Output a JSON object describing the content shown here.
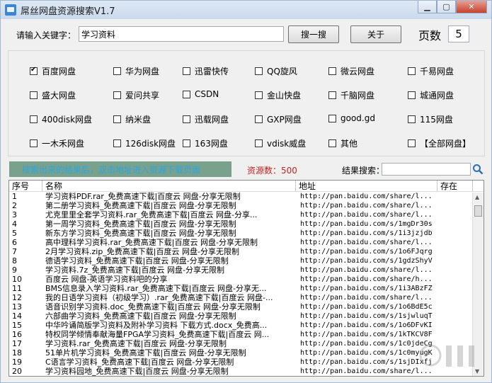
{
  "window": {
    "title": "屌丝网盘资源搜索V1.7"
  },
  "search": {
    "label": "请输入关键字：",
    "value": "学习资料",
    "search_button": "搜一搜",
    "about_button": "关于",
    "pages_label": "页数",
    "pages_value": "5"
  },
  "providers": [
    {
      "label": "百度网盘",
      "checked": true
    },
    {
      "label": "华为网盘",
      "checked": false
    },
    {
      "label": "迅雷快传",
      "checked": false
    },
    {
      "label": "QQ旋风",
      "checked": false
    },
    {
      "label": "微云网盘",
      "checked": false
    },
    {
      "label": "千易网盘",
      "checked": false
    },
    {
      "label": "盛大网盘",
      "checked": false
    },
    {
      "label": "爱问共享",
      "checked": false
    },
    {
      "label": "CSDN",
      "checked": false
    },
    {
      "label": "金山快盘",
      "checked": false
    },
    {
      "label": "千脑网盘",
      "checked": false
    },
    {
      "label": "城通网盘",
      "checked": false
    },
    {
      "label": "400disk网盘",
      "checked": false
    },
    {
      "label": "纳米盘",
      "checked": false
    },
    {
      "label": "迅载网盘",
      "checked": false
    },
    {
      "label": "GXP网盘",
      "checked": false
    },
    {
      "label": "good.gd",
      "checked": false
    },
    {
      "label": "115网盘",
      "checked": false
    },
    {
      "label": "一木禾网盘",
      "checked": false
    },
    {
      "label": "126disk网盘",
      "checked": false
    },
    {
      "label": "163网盘",
      "checked": false
    },
    {
      "label": "vdisk威盘",
      "checked": false
    },
    {
      "label": "其他",
      "checked": false
    },
    {
      "label": "【全部网盘】",
      "checked": false
    }
  ],
  "status": {
    "hint": "搜索出来的结果后，双击地址进入资源下载页面",
    "count": "资源数：500",
    "result_search_label": "结果搜索："
  },
  "table": {
    "headers": [
      "序号",
      "名称",
      "地址",
      "存在"
    ],
    "rows": [
      [
        "1",
        "学习资料PDF.rar_免费高速下载|百度云 网盘-分享无限制",
        "http://pan.baidu.com/share/l..."
      ],
      [
        "2",
        "第二册学习资料_免费高速下载|百度云 网盘-分享无限制",
        "http://pan.baidu.com/share/l..."
      ],
      [
        "3",
        "尤克里里全套学习资料.rar_免费高速下载|百度云 网盘-分享...",
        "http://pan.baidu.com/share/l..."
      ],
      [
        "4",
        "第一周学习资料_免费高速下载|百度云 网盘-分享无限制",
        "http://pan.baidu.com/s/1mgDr30s"
      ],
      [
        "5",
        "新东方学习资料_免费高速下载|百度云 网盘-分享无限制",
        "http://pan.baidu.com/s/1i3jzjdb"
      ],
      [
        "6",
        "高中理科学习资料.rar_免费高速下载|百度云 网盘-分享无限制",
        "http://pan.baidu.com/share/l..."
      ],
      [
        "7",
        "2月学习资料.zip_免费高速下载|百度云 网盘-分享无限制",
        "http://pan.baidu.com/s/1o6FJqrg"
      ],
      [
        "8",
        "德语学习资料_免费高速下载|百度云 网盘-分享无限制",
        "http://pan.baidu.com/s/1gdzShyV"
      ],
      [
        "9",
        "学习资料.7z_免费高速下载|百度云 网盘-分享无限制",
        "http://pan.baidu.com/share/l..."
      ],
      [
        "10",
        "百度云 网盘-英语学习资料吧的分享",
        "http://pan.baidu.com/share/h..."
      ],
      [
        "11",
        "BMS信息录入学习资料.rar_免费高速下载|百度云 网盘-分享无...",
        "http://pan.baidu.com/s/1i3ABzFZ"
      ],
      [
        "12",
        "我的日语学习资料（初级学习）.rar_免费高速下载|百度云 网盘-...",
        "http://pan.baidu.com/share/l..."
      ],
      [
        "13",
        "语音识别学习资料.doc_免费高速下载|百度云 网盘-分享无限制",
        "http://pan.baidu.com/s/1o6BdE5c"
      ],
      [
        "14",
        "六部曲学习资料_免费高速下载|百度云 网盘-分享无限制",
        "http://pan.baidu.com/s/1sjwluqT"
      ],
      [
        "15",
        "中华吟诵简版学习资料及附补学习资料 下载方式.docx_免费高...",
        "http://pan.baidu.com/s/1o6DFvKI"
      ],
      [
        "16",
        "特权同学倾情奉献海量FPGA学习资料_免费高速下载|百度云 网...",
        "http://pan.baidu.com/s/1kTKCV8F"
      ],
      [
        "17",
        "学习资料.rar_免费高速下载|百度云 网盘-分享无限制",
        "http://pan.baidu.com/s/1c0jdeCg"
      ],
      [
        "18",
        "51单片机学习资料_免费高速下载|百度云 网盘-分享无限制",
        "http://pan.baidu.com/s/1c0myugK"
      ],
      [
        "19",
        "C语言学习资料_免费高速下载|百度云 网盘-分享无限制",
        "http://pan.baidu.com/s/1sjDIxfj"
      ],
      [
        "20",
        "学习资料园地_免费高速下载|百度云 网盘-分享无限制",
        "http://pan.baidu.com/share/l..."
      ]
    ]
  }
}
